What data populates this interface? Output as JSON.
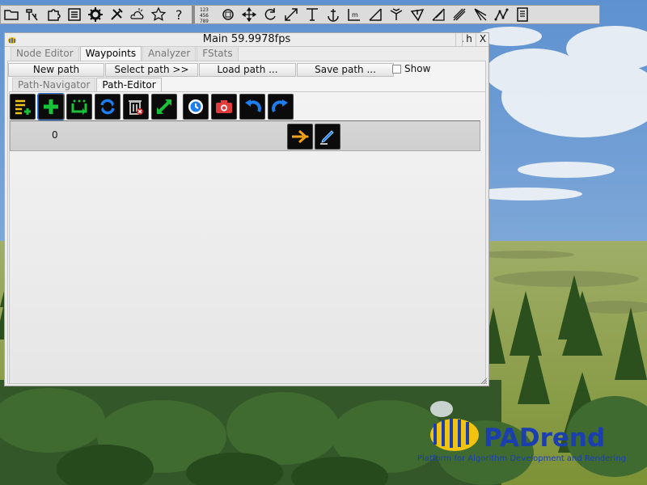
{
  "window": {
    "title": "Main 59.9978fps",
    "controls": {
      "dock": ".",
      "hide": "h",
      "close": "X"
    }
  },
  "main_tabs": [
    {
      "label": "Node Editor",
      "active": false
    },
    {
      "label": "Waypoints",
      "active": true
    },
    {
      "label": "Analyzer",
      "active": false
    },
    {
      "label": "FStats",
      "active": false
    }
  ],
  "path_buttons": {
    "new_path": "New path",
    "select_path": "Select path >>",
    "load_path": "Load path ...",
    "save_path": "Save path ..."
  },
  "show_checkbox": {
    "label": "Show",
    "checked": false
  },
  "sub_tabs": [
    {
      "label": "Path-Navigator",
      "active": false
    },
    {
      "label": "Path-Editor",
      "active": true
    }
  ],
  "editor_toolbar_icons": [
    "add-list-icon",
    "add-waypoint-icon",
    "loop-icon",
    "refresh-icon",
    "delete-path-icon",
    "fit-expand-icon",
    "timing-gear-icon",
    "screenshot-camera-icon",
    "undo-icon",
    "redo-icon"
  ],
  "waypoints": [
    {
      "index": "0",
      "actions": [
        "goto-waypoint-icon",
        "edit-waypoint-icon"
      ]
    }
  ],
  "top_toolbar_icons": [
    "folder-icon",
    "scene-tools-icon",
    "plugin-puzzle-icon",
    "list-icon",
    "settings-gear-icon",
    "tools-icon",
    "weather-icon",
    "bookmark-star-icon",
    "help-icon",
    "numbers-grid-icon",
    "camera-rotate-icon",
    "move-icon",
    "rotate-icon",
    "scale-icon",
    "align-top-icon",
    "anchor-icon",
    "measure-icon",
    "transform-1-icon",
    "transform-2-icon",
    "transform-3-icon",
    "transform-4-icon",
    "transform-5-icon",
    "transform-6-icon",
    "path-icon",
    "notes-icon"
  ],
  "logo": {
    "wordmark": "PADrend",
    "tagline": "Platform for Algorithm Development and Rendering"
  },
  "colors": {
    "sky": "#6f9fd2",
    "grass": "#8ea248",
    "logo_blue": "#1b3fae",
    "logo_yellow": "#f2c410",
    "icon_green": "#19c339",
    "icon_blue": "#1d7ef0",
    "icon_orange": "#f5a21a"
  }
}
